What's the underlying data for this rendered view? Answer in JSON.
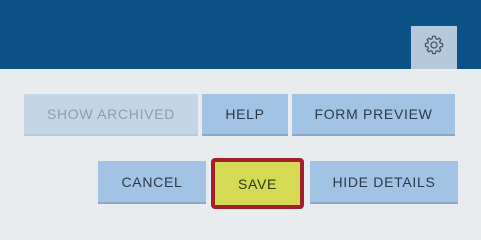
{
  "header": {
    "settings_icon": "gear-icon"
  },
  "toolbar_row1": {
    "show_archived_label": "SHOW ARCHIVED",
    "help_label": "HELP",
    "form_preview_label": "FORM PREVIEW"
  },
  "toolbar_row2": {
    "cancel_label": "CANCEL",
    "save_label": "SAVE",
    "hide_details_label": "HIDE DETAILS"
  },
  "colors": {
    "header_bg": "#0b5287",
    "page_bg": "#e9ecef",
    "button_bg": "#a3c3e4",
    "button_disabled_bg": "#c3d6e8",
    "save_bg": "#d5da55",
    "save_highlight_border": "#a21f2d"
  }
}
